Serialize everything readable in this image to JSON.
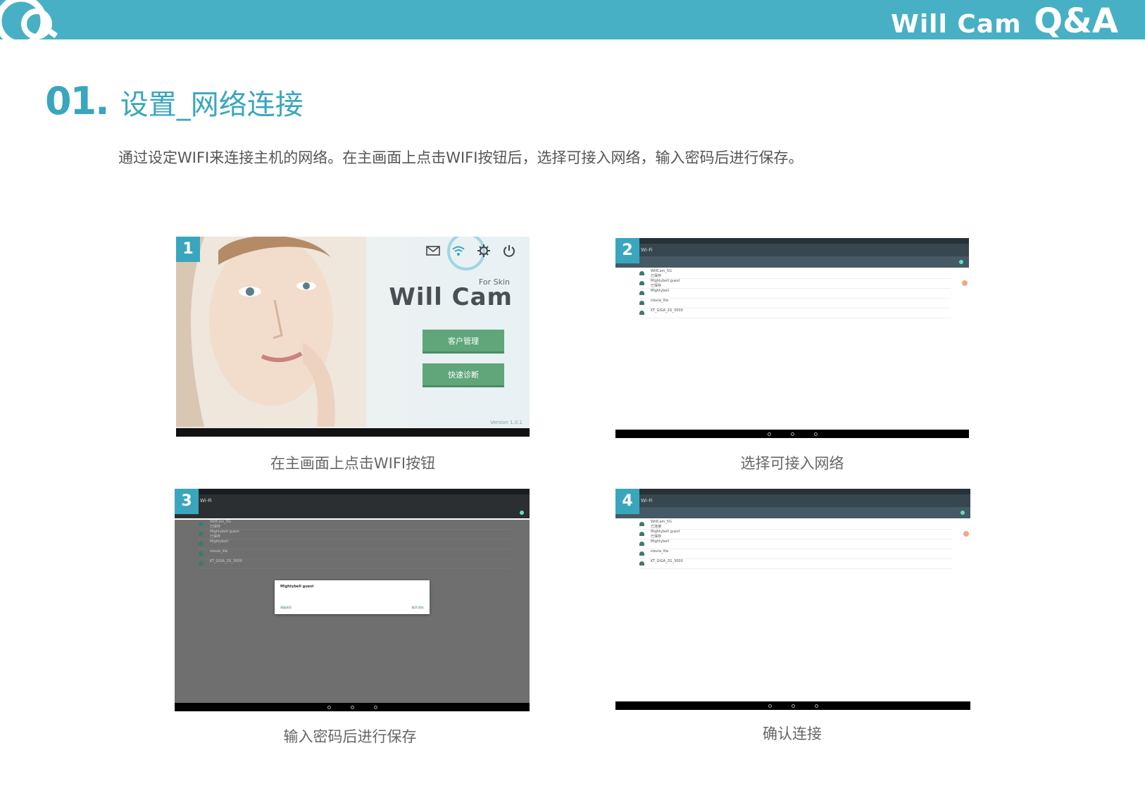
{
  "header": {
    "brand": "Will Cam",
    "qa": "Q&A",
    "bar_color": "#48b0c4",
    "accent_color": "#3aa6bd"
  },
  "section": {
    "number": "01.",
    "title": "设置_网络连接",
    "description": "通过设定WIFI来连接主机的网络。在主画面上点击WIFI按钮后，选择可接入网络，输入密码后进行保存。"
  },
  "panels": [
    {
      "badge": "1",
      "caption": "在主画面上点击WIFI按钮",
      "for_skin": "For Skin",
      "logo": "Will Cam",
      "buttons": [
        "客户管理",
        "快速诊断"
      ],
      "version": "Version 1.0.1"
    },
    {
      "badge": "2",
      "caption": "选择可接入网络",
      "appbar": "Wi-Fi",
      "networks": [
        {
          "name": "WillCam_5G",
          "sub": "已保存"
        },
        {
          "name": "Mightybell guest",
          "sub": "已保存"
        },
        {
          "name": "Mightybell"
        },
        {
          "name": "stevia_lite"
        },
        {
          "name": "KT_GiGA_2G_3000"
        }
      ]
    },
    {
      "badge": "3",
      "caption": "输入密码后进行保存",
      "appbar": "Wi-Fi",
      "dialog_title": "Mightybell guest",
      "dialog_left": "高级选项",
      "dialog_right": "取消  保存",
      "networks": [
        {
          "name": "WillCam_5G",
          "sub": "已保存"
        },
        {
          "name": "Mightybell guest",
          "sub": "已保存"
        },
        {
          "name": "Mightybell"
        },
        {
          "name": "stevia_lite"
        },
        {
          "name": "KT_GiGA_2G_3000"
        }
      ]
    },
    {
      "badge": "4",
      "caption": "确认连接",
      "appbar": "Wi-Fi",
      "networks": [
        {
          "name": "WillCam_5G",
          "sub": "已连接"
        },
        {
          "name": "Mightybell guest",
          "sub": "已保存"
        },
        {
          "name": "Mightybell"
        },
        {
          "name": "stevia_lite"
        },
        {
          "name": "KT_GiGA_2G_3000"
        }
      ]
    }
  ]
}
